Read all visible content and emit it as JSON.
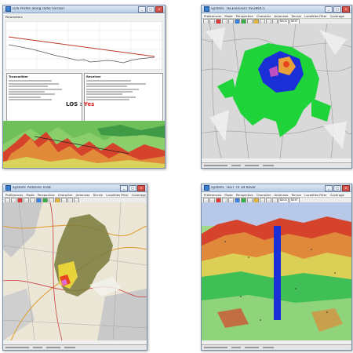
{
  "windows": {
    "los": {
      "title": "LOS Profile along radio horizon",
      "panel_label": "Parameters",
      "transmitter_heading": "Transmitter",
      "receiver_heading": "Receiver",
      "los_label": "LOS :",
      "los_value": "Yes"
    },
    "telesoggi": {
      "title": "System: TELESOGGI5 VEGNOC5",
      "menu": [
        "Preferences",
        "Mode",
        "Perspective",
        "Character",
        "Antennas",
        "Terrain",
        "Localities Filter",
        "Coverage"
      ],
      "toolbar_buttons": [
        "BACK",
        "NEXT"
      ]
    },
    "antenne": {
      "title": "System: Antenne Trieb",
      "menu": [
        "Preferences",
        "Mode",
        "Perspective",
        "Character",
        "Antennas",
        "Terrain",
        "Localities Filter",
        "Coverage"
      ]
    },
    "test3d": {
      "title": "System: TEST TV 3d Rover",
      "menu": [
        "Preferences",
        "Mode",
        "Perspective",
        "Character",
        "Antennas",
        "Terrain",
        "Localities Filter",
        "Coverage"
      ],
      "toolbar_buttons": [
        "BACK",
        "NEXT"
      ]
    }
  },
  "colors": {
    "window_border": "#7a8ea8",
    "coverage_green": "#1fd43a",
    "coverage_blue": "#1a2fd6",
    "los_yes": "#d81e1e",
    "terrain_red": "#d6432c",
    "terrain_green": "#5fb85a"
  }
}
